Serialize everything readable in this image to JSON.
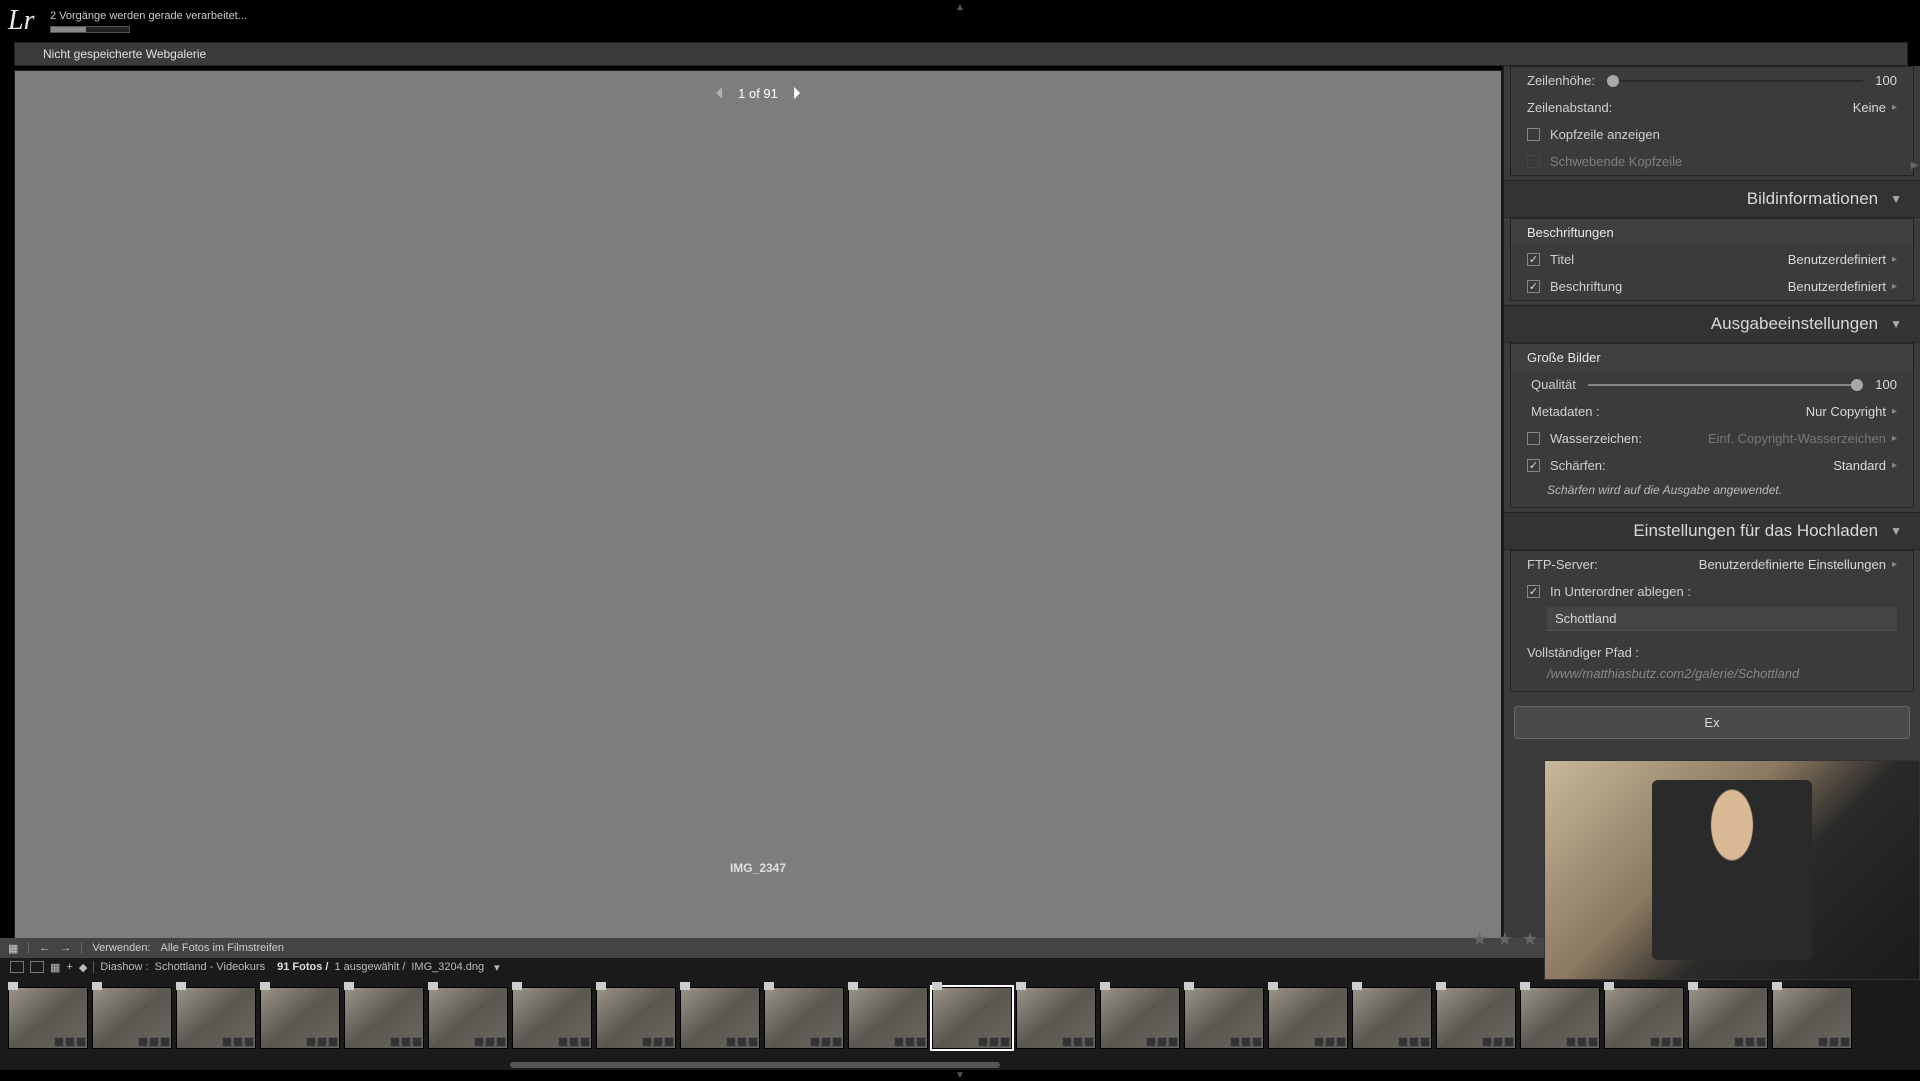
{
  "app": {
    "logo": "Lr",
    "status": "2 Vorgänge werden gerade verarbeitet..."
  },
  "gallery": {
    "header": "Nicht gespeicherte Webgalerie"
  },
  "pager": {
    "text": "1 of 91"
  },
  "image": {
    "title": "IMG_2347"
  },
  "panels": {
    "row_height": {
      "label": "Zeilenhöhe:",
      "value": "100"
    },
    "row_spacing": {
      "label": "Zeilenabstand:",
      "value": "Keine"
    },
    "show_header": {
      "label": "Kopfzeile anzeigen"
    },
    "floating_header": {
      "label": "Schwebende Kopfzeile"
    },
    "image_info": {
      "title": "Bildinformationen"
    },
    "captions": {
      "subhead": "Beschriftungen"
    },
    "title_row": {
      "label": "Titel",
      "value": "Benutzerdefiniert"
    },
    "caption_row": {
      "label": "Beschriftung",
      "value": "Benutzerdefiniert"
    },
    "output": {
      "title": "Ausgabeeinstellungen"
    },
    "large_images": {
      "subhead": "Große Bilder"
    },
    "quality": {
      "label": "Qualität",
      "value": "100"
    },
    "metadata": {
      "label": "Metadaten :",
      "value": "Nur Copyright"
    },
    "watermark": {
      "label": "Wasserzeichen:",
      "value": "Einf. Copyright-Wasserzeichen"
    },
    "sharpen": {
      "label": "Schärfen:",
      "value": "Standard"
    },
    "sharpen_note": "Schärfen wird auf die Ausgabe angewendet.",
    "upload": {
      "title": "Einstellungen für das Hochladen"
    },
    "ftp": {
      "label": "FTP-Server:",
      "value": "Benutzerdefinierte Einstellungen"
    },
    "subfolder": {
      "label": "In Unterordner ablegen :",
      "value": "Schottland"
    },
    "fullpath": {
      "label": "Vollständiger Pfad :",
      "value": "/www/matthiasbutz.com2/galerie/Schottland"
    },
    "export_btn": "Ex"
  },
  "toolbar": {
    "use_label": "Verwenden:",
    "use_value": "Alle Fotos im Filmstreifen"
  },
  "filmstrip": {
    "breadcrumb_1": "Diashow :",
    "breadcrumb_2": "Schottland - Videokurs",
    "count": "91 Fotos /",
    "selected": "1 ausgewählt /",
    "filename": "IMG_3204.dng",
    "thumbs": 22
  },
  "stars": "★ ★ ★"
}
